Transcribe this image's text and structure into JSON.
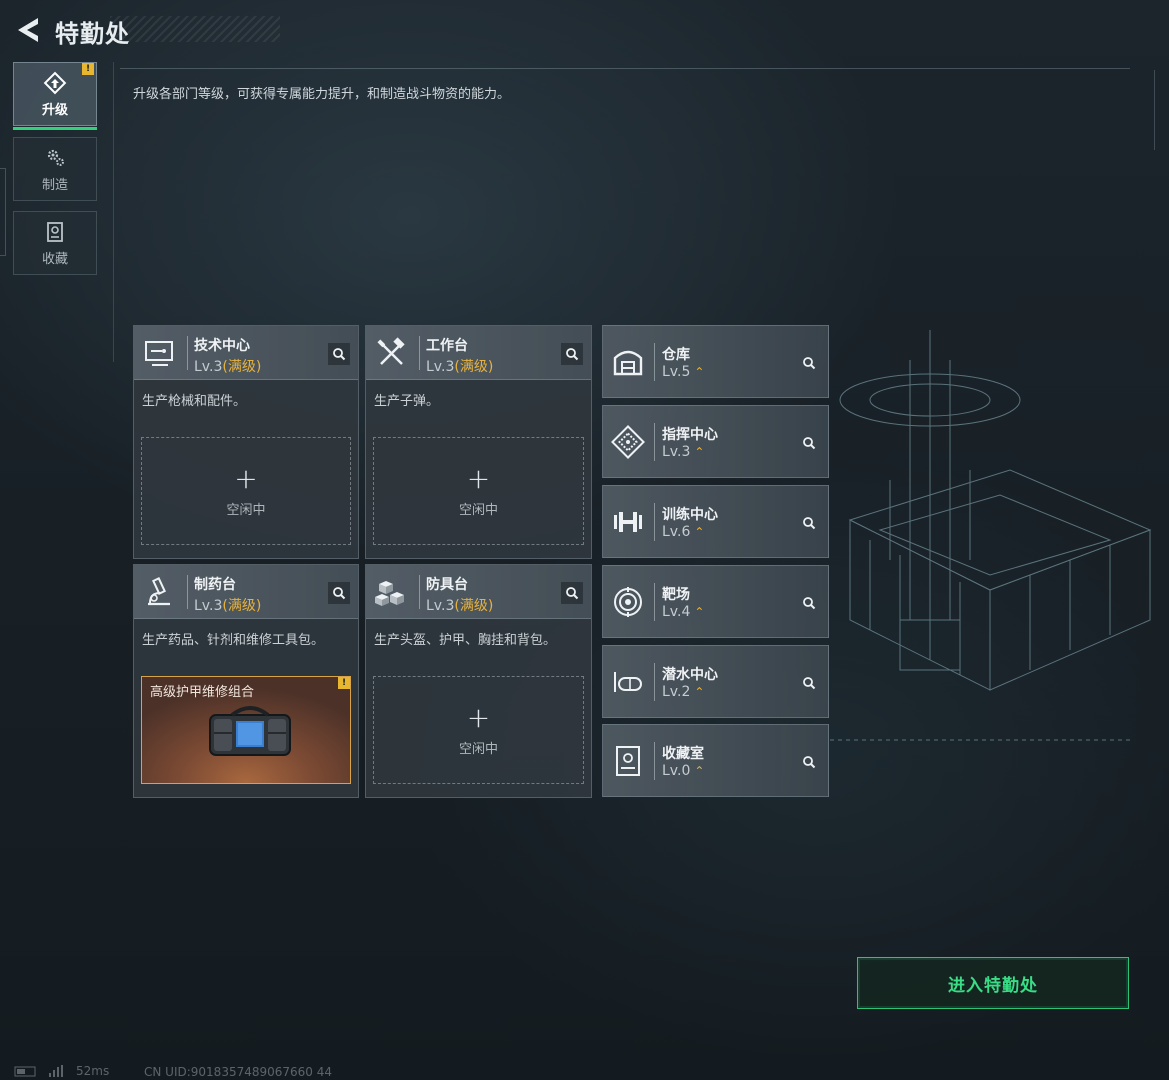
{
  "header": {
    "title": "特勤处"
  },
  "nav": [
    {
      "label": "升级",
      "icon": "upgrade-icon",
      "active": true,
      "badge": "!"
    },
    {
      "label": "制造",
      "icon": "gears-icon",
      "active": false
    },
    {
      "label": "收藏",
      "icon": "collection-icon",
      "active": false
    }
  ],
  "description": "升级各部门等级，可获得专属能力提升，和制造战斗物资的能力。",
  "cards": [
    {
      "name": "技术中心",
      "level": "Lv.3",
      "max": "(满级)",
      "desc": "生产枪械和配件。",
      "slot": {
        "plus": "+",
        "status": "空闲中"
      },
      "icon": "monitor-icon"
    },
    {
      "name": "工作台",
      "level": "Lv.3",
      "max": "(满级)",
      "desc": "生产子弹。",
      "slot": {
        "plus": "+",
        "status": "空闲中"
      },
      "icon": "tools-icon"
    },
    {
      "name": "制药台",
      "level": "Lv.3",
      "max": "(满级)",
      "desc": "生产药品、针剂和维修工具包。",
      "product": {
        "name": "高级护甲维修组合",
        "badge": "!"
      },
      "icon": "microscope-icon"
    },
    {
      "name": "防具台",
      "level": "Lv.3",
      "max": "(满级)",
      "desc": "生产头盔、护甲、胸挂和背包。",
      "slot": {
        "plus": "+",
        "status": "空闲中"
      },
      "icon": "armor-blocks-icon"
    }
  ],
  "facilities": [
    {
      "name": "仓库",
      "level": "Lv.5",
      "icon": "warehouse-icon",
      "upgrade_arrow": "⌃"
    },
    {
      "name": "指挥中心",
      "level": "Lv.3",
      "icon": "command-icon",
      "upgrade_arrow": "⌃"
    },
    {
      "name": "训练中心",
      "level": "Lv.6",
      "icon": "dumbbell-icon",
      "upgrade_arrow": "⌃"
    },
    {
      "name": "靶场",
      "level": "Lv.4",
      "icon": "target-icon",
      "upgrade_arrow": "⌃"
    },
    {
      "name": "潜水中心",
      "level": "Lv.2",
      "icon": "diving-mask-icon",
      "upgrade_arrow": "⌃"
    },
    {
      "name": "收藏室",
      "level": "Lv.0",
      "icon": "display-case-icon",
      "upgrade_arrow": "⌃"
    }
  ],
  "enter_button": "进入特勤处",
  "status": {
    "ping": "52ms",
    "uid": "CN UID:9018357489067660 44"
  },
  "colors": {
    "accent_green": "#35d07b",
    "max_level": "#e7b23e",
    "badge": "#e8b730"
  }
}
